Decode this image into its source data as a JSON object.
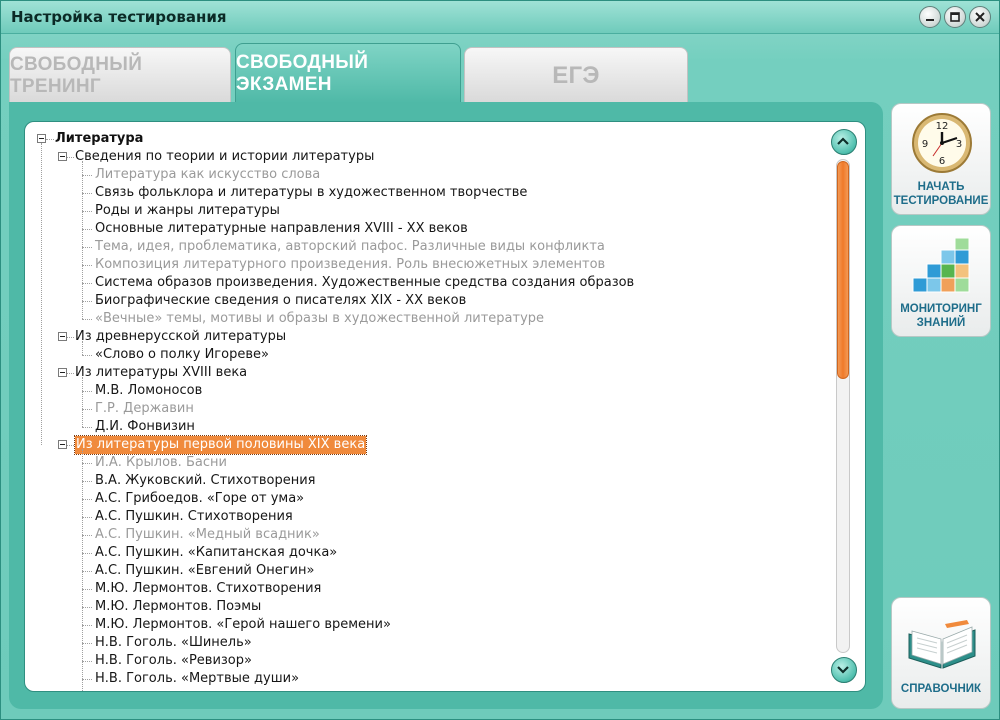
{
  "window": {
    "title": "Настройка тестирования"
  },
  "tabs": [
    {
      "label": "СВОБОДНЫЙ ТРЕНИНГ",
      "active": false
    },
    {
      "label": "СВОБОДНЫЙ ЭКЗАМЕН",
      "active": true
    },
    {
      "label": "ЕГЭ",
      "active": false
    }
  ],
  "colors": {
    "accent": "#4fb9a7",
    "selection": "#f08a3c",
    "scrollbar_thumb": "#f07a2a",
    "disabled_text": "#9a9a9a"
  },
  "tree": {
    "rows": [
      {
        "level": 0,
        "text": "Литература",
        "expander": true,
        "enabled": true
      },
      {
        "level": 1,
        "text": "Сведения по теории и истории литературы",
        "expander": true,
        "enabled": true
      },
      {
        "level": 2,
        "text": "Литература как искусство слова",
        "enabled": false
      },
      {
        "level": 2,
        "text": "Связь фольклора и литературы в художественном творчестве",
        "enabled": true
      },
      {
        "level": 2,
        "text": "Роды и жанры литературы",
        "enabled": true
      },
      {
        "level": 2,
        "text": "Основные литературные направления XVIII - XX веков",
        "enabled": true
      },
      {
        "level": 2,
        "text": "Тема, идея, проблематика, авторский пафос. Различные виды конфликта",
        "enabled": false
      },
      {
        "level": 2,
        "text": "Композиция литературного произведения. Роль внесюжетных элементов",
        "enabled": false
      },
      {
        "level": 2,
        "text": "Система образов произведения. Художественные средства создания образов",
        "enabled": true
      },
      {
        "level": 2,
        "text": "Биографические сведения о писателях XIX - XX веков",
        "enabled": true
      },
      {
        "level": 2,
        "text": "«Вечные» темы, мотивы и образы в художественной литературе",
        "enabled": false
      },
      {
        "level": 1,
        "text": "Из древнерусской литературы",
        "expander": true,
        "enabled": true
      },
      {
        "level": 2,
        "text": "«Слово о полку Игореве»",
        "enabled": true
      },
      {
        "level": 1,
        "text": "Из литературы XVIII века",
        "expander": true,
        "enabled": true
      },
      {
        "level": 2,
        "text": "М.В. Ломоносов",
        "enabled": true
      },
      {
        "level": 2,
        "text": "Г.Р. Державин",
        "enabled": false
      },
      {
        "level": 2,
        "text": "Д.И. Фонвизин",
        "enabled": true
      },
      {
        "level": 1,
        "text": "Из литературы первой половины XIX века",
        "expander": true,
        "enabled": true,
        "selected": true
      },
      {
        "level": 2,
        "text": "И.А. Крылов. Басни",
        "enabled": false
      },
      {
        "level": 2,
        "text": "В.А. Жуковский. Стихотворения",
        "enabled": true
      },
      {
        "level": 2,
        "text": "А.С. Грибоедов. «Горе от ума»",
        "enabled": true
      },
      {
        "level": 2,
        "text": "А.С. Пушкин. Стихотворения",
        "enabled": true
      },
      {
        "level": 2,
        "text": "А.С. Пушкин. «Медный всадник»",
        "enabled": false
      },
      {
        "level": 2,
        "text": "А.С. Пушкин. «Капитанская дочка»",
        "enabled": true
      },
      {
        "level": 2,
        "text": "А.С. Пушкин. «Евгений Онегин»",
        "enabled": true
      },
      {
        "level": 2,
        "text": "М.Ю. Лермонтов. Стихотворения",
        "enabled": true
      },
      {
        "level": 2,
        "text": "М.Ю. Лермонтов. Поэмы",
        "enabled": true
      },
      {
        "level": 2,
        "text": "М.Ю. Лермонтов. «Герой нашего времени»",
        "enabled": true
      },
      {
        "level": 2,
        "text": "Н.В. Гоголь. «Шинель»",
        "enabled": true
      },
      {
        "level": 2,
        "text": "Н.В. Гоголь. «Ревизор»",
        "enabled": true
      },
      {
        "level": 2,
        "text": "Н.В. Гоголь. «Мертвые души»",
        "enabled": true
      }
    ]
  },
  "sidebar": {
    "start": {
      "line1": "НАЧАТЬ",
      "line2": "ТЕСТИРОВАНИЕ",
      "icon": "clock-icon",
      "clock": [
        "12",
        "3",
        "6",
        "9"
      ]
    },
    "monitor": {
      "line1": "МОНИТОРИНГ",
      "line2": "ЗНАНИЙ",
      "icon": "cubes-chart-icon"
    },
    "reference": {
      "line1": "СПРАВОЧНИК",
      "icon": "open-book-icon"
    }
  }
}
